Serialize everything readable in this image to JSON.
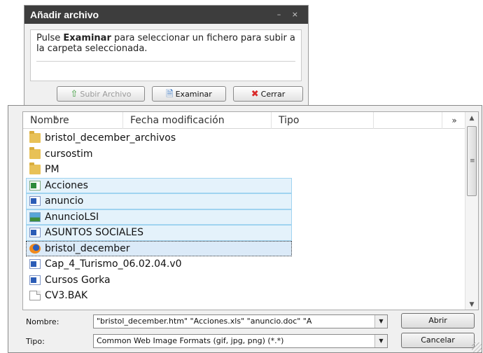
{
  "upload_dialog": {
    "title": "Añadir archivo",
    "window_buttons": "– ×",
    "message_prefix": "Pulse ",
    "message_bold": "Examinar",
    "message_suffix": " para seleccionar un fichero para subir a la carpeta seleccionada.",
    "buttons": {
      "upload": "Subir Archivo",
      "browse": "Examinar",
      "close": "Cerrar"
    }
  },
  "file_dialog": {
    "columns": [
      "Nombre",
      "Fecha modificación",
      "Tipo",
      "»"
    ],
    "files": [
      {
        "name": "bristol_december_archivos",
        "icon": "folder-icon"
      },
      {
        "name": "cursostim",
        "icon": "folder-icon"
      },
      {
        "name": "PM",
        "icon": "folder-icon"
      },
      {
        "name": "Acciones",
        "icon": "excel-file-icon"
      },
      {
        "name": "anuncio",
        "icon": "word-file-icon"
      },
      {
        "name": "AnuncioLSI",
        "icon": "image-file-icon"
      },
      {
        "name": "ASUNTOS SOCIALES",
        "icon": "word-file-icon"
      },
      {
        "name": "bristol_december",
        "icon": "firefox-html-icon"
      },
      {
        "name": "Cap_4_Turismo_06.02.04.v0",
        "icon": "word-file-icon"
      },
      {
        "name": "Cursos Gorka",
        "icon": "word-file-icon"
      },
      {
        "name": "CV3.BAK",
        "icon": "blank-file-icon"
      }
    ],
    "filename_label": "Nombre:",
    "filename_value": "\"bristol_december.htm\" \"Acciones.xls\" \"anuncio.doc\" \"A",
    "filetype_label": "Tipo:",
    "filetype_value": "Common Web Image Formats (gif, jpg, png) (*.*)",
    "open_button": "Abrir",
    "cancel_button": "Cancelar"
  }
}
